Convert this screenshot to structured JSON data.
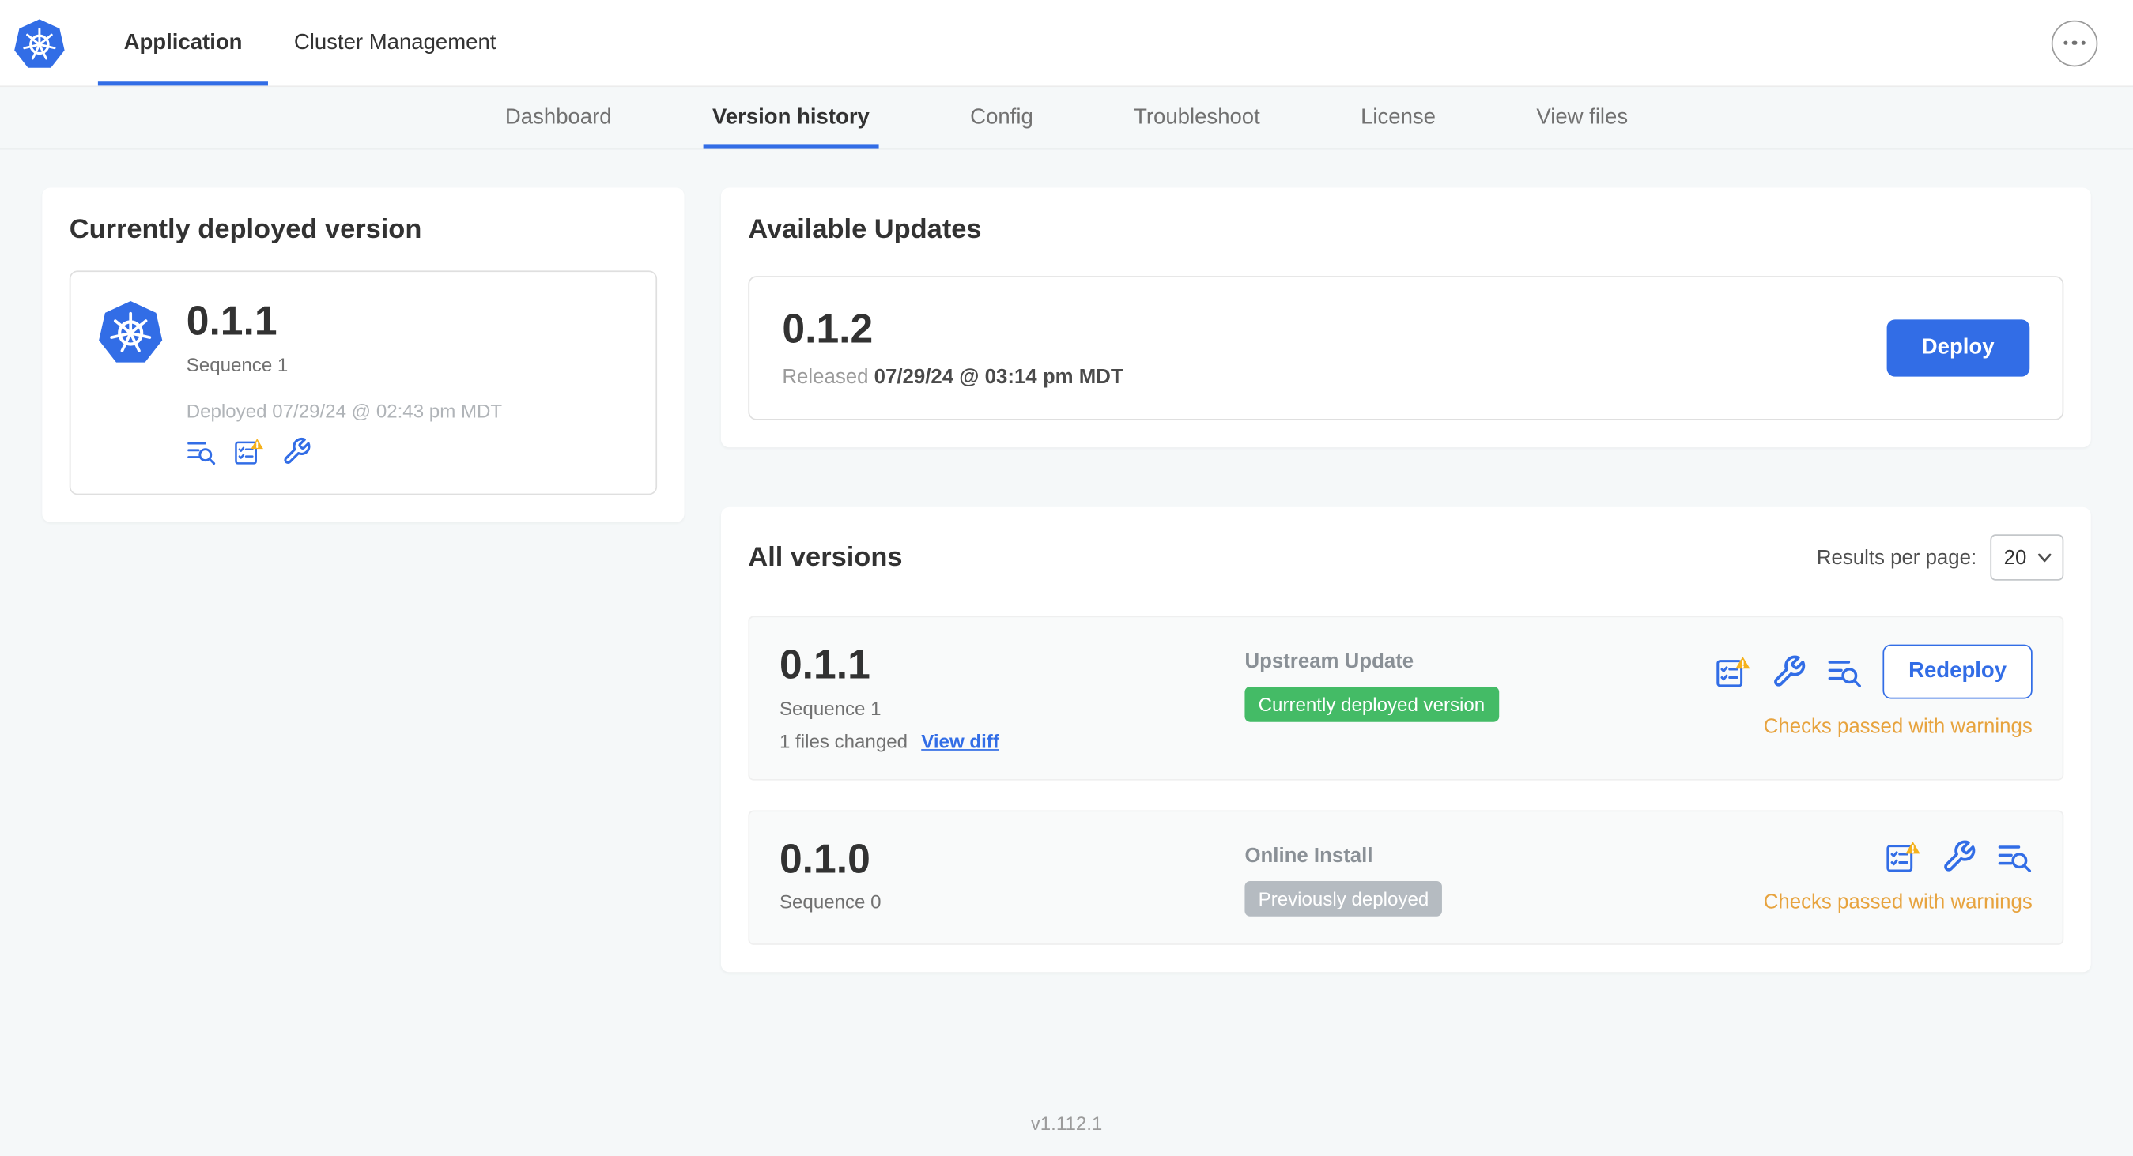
{
  "colors": {
    "accent": "#326de6",
    "green": "#44bb66",
    "gray-badge": "#b5bbc1",
    "warning": "#e7a33e",
    "warning-triangle": "#f5b11b"
  },
  "header": {
    "tabs": [
      {
        "label": "Application"
      },
      {
        "label": "Cluster Management"
      }
    ]
  },
  "subnav": {
    "items": [
      "Dashboard",
      "Version history",
      "Config",
      "Troubleshoot",
      "License",
      "View files"
    ],
    "active": "Version history"
  },
  "deployed_card": {
    "title": "Currently deployed version",
    "version": "0.1.1",
    "sequence": "Sequence 1",
    "deployed_at": "Deployed 07/29/24 @ 02:43 pm MDT"
  },
  "available_updates": {
    "title": "Available Updates",
    "version": "0.1.2",
    "released_prefix": "Released",
    "released_at": "07/29/24 @ 03:14 pm MDT",
    "deploy_label": "Deploy"
  },
  "all_versions": {
    "title": "All versions",
    "results_per_page_label": "Results per page:",
    "results_per_page_value": "20",
    "rows": [
      {
        "version": "0.1.1",
        "sequence": "Sequence 1",
        "files_changed": "1 files changed",
        "view_diff_label": "View diff",
        "source": "Upstream Update",
        "badge": "Currently deployed version",
        "status": "Checks passed with warnings",
        "action_label": "Redeploy"
      },
      {
        "version": "0.1.0",
        "sequence": "Sequence 0",
        "source": "Online Install",
        "badge": "Previously deployed",
        "status": "Checks passed with warnings"
      }
    ]
  },
  "footer": {
    "version": "v1.112.1"
  }
}
